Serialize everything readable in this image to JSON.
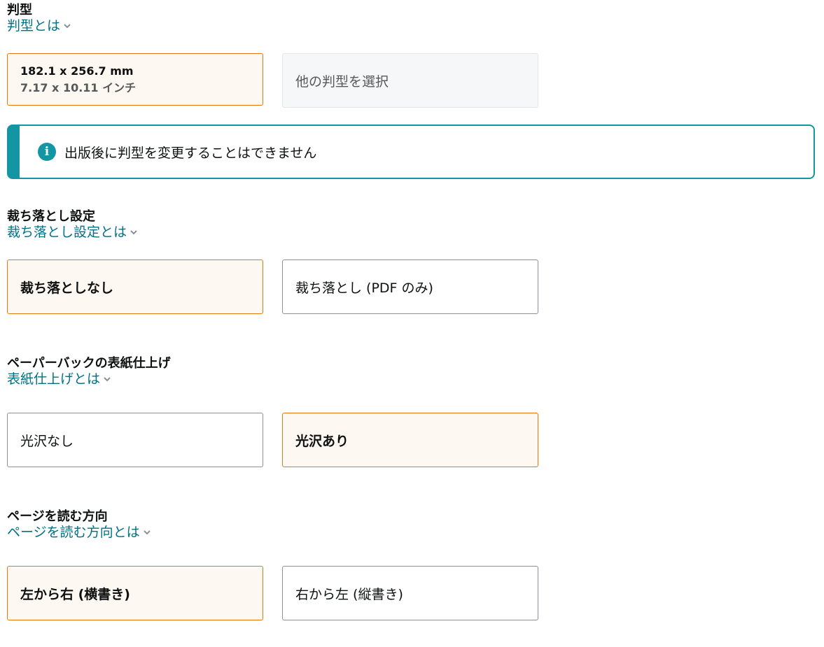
{
  "trim": {
    "title": "判型",
    "help": "判型とは",
    "selected": {
      "size_mm": "182.1 x 256.7 mm",
      "size_in": "7.17 x 10.11 インチ"
    },
    "other_label": "他の判型を選択"
  },
  "alert": {
    "icon": "i",
    "text": "出版後に判型を変更することはできません"
  },
  "bleed": {
    "title": "裁ち落とし設定",
    "help": "裁ち落とし設定とは",
    "options": [
      "裁ち落としなし",
      "裁ち落とし (PDF のみ)"
    ],
    "selected_index": 0
  },
  "cover": {
    "title": "ペーパーバックの表紙仕上げ",
    "help": "表紙仕上げとは",
    "options": [
      "光沢なし",
      "光沢あり"
    ],
    "selected_index": 1
  },
  "direction": {
    "title": "ページを読む方向",
    "help": "ページを読む方向とは",
    "options": [
      "左から右 (横書き)",
      "右から左 (縦書き)"
    ],
    "selected_index": 0
  },
  "colors": {
    "link": "#007185",
    "selected_border": "#e47911",
    "selected_bg": "#fef8f2",
    "alert": "#1395a3"
  }
}
